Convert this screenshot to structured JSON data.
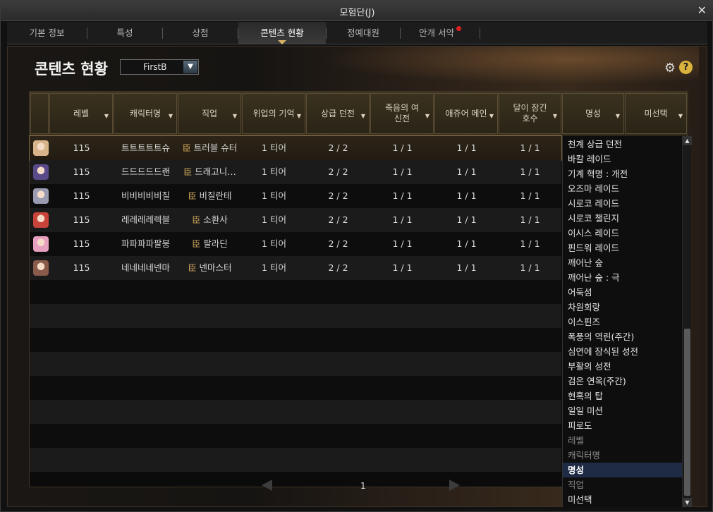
{
  "window": {
    "title": "모험단(J)",
    "close_label": "✕"
  },
  "tabs": [
    {
      "label": "기본 정보"
    },
    {
      "label": "특성"
    },
    {
      "label": "상점"
    },
    {
      "label": "콘텐츠 현황",
      "active": true
    },
    {
      "label": "정예대원"
    },
    {
      "label": "안개 서약",
      "badge": "!"
    }
  ],
  "panel": {
    "heading": "콘텐츠 현황",
    "character_select": "FirstB",
    "help_label": "?"
  },
  "columns": [
    {
      "label": ""
    },
    {
      "label": "레벨"
    },
    {
      "label": "캐릭터명"
    },
    {
      "label": "직업"
    },
    {
      "label": "위업의 기억"
    },
    {
      "label": "상급 던전"
    },
    {
      "label": "죽음의 여신전"
    },
    {
      "label": "애쥬어 메인"
    },
    {
      "label": "달이 잠긴 호수"
    },
    {
      "label": "명성"
    },
    {
      "label": "미선택"
    }
  ],
  "rows": [
    {
      "level": "115",
      "name": "트트트트트슈",
      "job": "트러블 슈터",
      "memory": "1 티어",
      "dungeon": "2 / 2",
      "goddess": "1 / 1",
      "azure": "1 / 1",
      "lake": "1 / 1",
      "avatar_color": "#d8b48a"
    },
    {
      "level": "115",
      "name": "드드드드드랜",
      "job": "드래고니…",
      "memory": "1 티어",
      "dungeon": "2 / 2",
      "goddess": "1 / 1",
      "azure": "1 / 1",
      "lake": "1 / 1",
      "avatar_color": "#5a4a8a"
    },
    {
      "level": "115",
      "name": "비비비비비질",
      "job": "비질란테",
      "memory": "1 티어",
      "dungeon": "2 / 2",
      "goddess": "1 / 1",
      "azure": "1 / 1",
      "lake": "1 / 1",
      "avatar_color": "#9a9ab0"
    },
    {
      "level": "115",
      "name": "레레레레렉블",
      "job": "소환사",
      "memory": "1 티어",
      "dungeon": "2 / 2",
      "goddess": "1 / 1",
      "azure": "1 / 1",
      "lake": "1 / 1",
      "avatar_color": "#c8443a"
    },
    {
      "level": "115",
      "name": "파파파파팔붕",
      "job": "팔라딘",
      "memory": "1 티어",
      "dungeon": "2 / 2",
      "goddess": "1 / 1",
      "azure": "1 / 1",
      "lake": "1 / 1",
      "avatar_color": "#e8a0c0"
    },
    {
      "level": "115",
      "name": "네네네네넨마",
      "job": "넨마스터",
      "memory": "1 티어",
      "dungeon": "2 / 2",
      "goddess": "1 / 1",
      "azure": "1 / 1",
      "lake": "1 / 1",
      "avatar_color": "#8a5a4a"
    }
  ],
  "job_icon": "👾",
  "dropdown": [
    {
      "label": "천계 상급 던전"
    },
    {
      "label": "바칼 레이드"
    },
    {
      "label": "기계 혁명 : 개전"
    },
    {
      "label": "오즈마 레이드"
    },
    {
      "label": "시로코 레이드"
    },
    {
      "label": "시로코 챌린지"
    },
    {
      "label": "이시스 레이드"
    },
    {
      "label": "핀드워 레이드"
    },
    {
      "label": "깨어난 숲"
    },
    {
      "label": "깨어난 숲 : 극"
    },
    {
      "label": "어둑섬"
    },
    {
      "label": "차원회랑"
    },
    {
      "label": "이스핀즈"
    },
    {
      "label": "폭풍의 역린(주간)"
    },
    {
      "label": "심연에 잠식된 성전"
    },
    {
      "label": "부활의 성전"
    },
    {
      "label": "검은 연옥(주간)"
    },
    {
      "label": "현혹의 탑"
    },
    {
      "label": "일일 미션"
    },
    {
      "label": "피로도"
    },
    {
      "label": "레벨",
      "dim": true
    },
    {
      "label": "캐릭터명",
      "dim": true
    },
    {
      "label": "명성",
      "highlight": true
    },
    {
      "label": "직업",
      "dim": true
    },
    {
      "label": "미선택"
    }
  ],
  "pager": {
    "page": "1"
  }
}
